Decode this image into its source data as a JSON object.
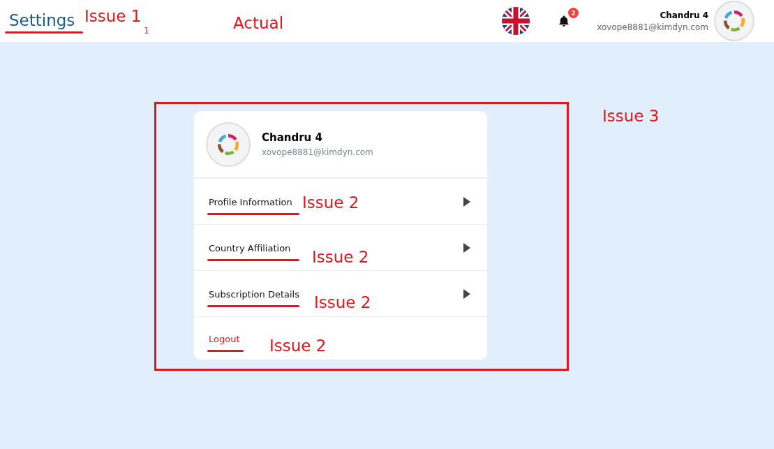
{
  "header": {
    "title": "Settings",
    "title_underlined": true,
    "notifications": "2",
    "user": {
      "name": "Chandru 4",
      "email": "xovope8881@kimdyn.com"
    }
  },
  "card": {
    "name": "Chandru 4",
    "email": "xovope8881@kimdyn.com",
    "items": [
      {
        "label": "Profile Information",
        "kind": "link",
        "underlined": true
      },
      {
        "label": "Country Affiliation",
        "kind": "link",
        "underlined": true
      },
      {
        "label": "Subscription Details",
        "kind": "link",
        "underlined": true
      },
      {
        "label": "Logout",
        "kind": "logout",
        "underlined": true
      }
    ]
  },
  "annotations": [
    {
      "text": "Issue 1"
    },
    {
      "text": "1"
    },
    {
      "text": "Actual"
    },
    {
      "text": "Issue 3"
    },
    {
      "text": "Issue 2"
    },
    {
      "text": "Issue 2"
    },
    {
      "text": "Issue 2"
    },
    {
      "text": "Issue 2"
    }
  ]
}
